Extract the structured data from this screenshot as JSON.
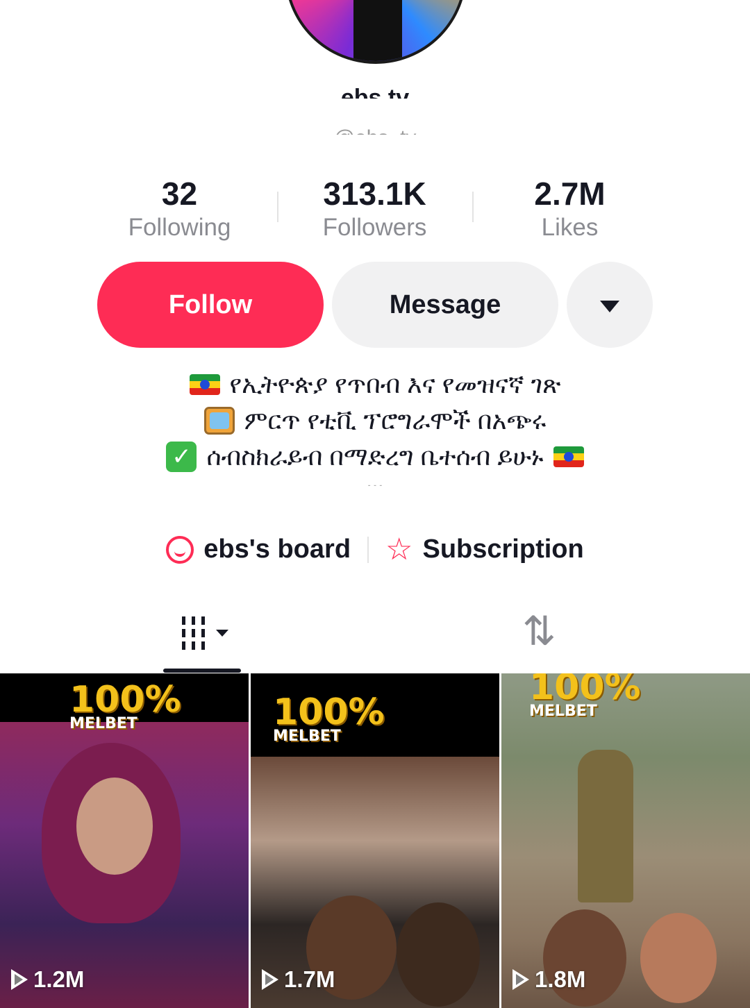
{
  "profile": {
    "display_name": "ebs tv",
    "handle": "@ebs_tv"
  },
  "stats": [
    {
      "value": "32",
      "label": "Following"
    },
    {
      "value": "313.1K",
      "label": "Followers"
    },
    {
      "value": "2.7M",
      "label": "Likes"
    }
  ],
  "actions": {
    "follow_label": "Follow",
    "message_label": "Message"
  },
  "bio": {
    "line1": "የኢትዮጵያ የጥበብ እና የመዝናኛ ገጽ",
    "line2": "ምርጥ የቲቪ ፕሮግራሞች በአጭሩ",
    "line3": "ሰብስክራይብ በማድረግ ቤተሰብ ይሁኑ",
    "line4_partial": "..."
  },
  "links": {
    "board_label": "ebs's board",
    "subscription_label": "Subscription"
  },
  "videos": [
    {
      "views": "1.2M",
      "badge_text": "100%",
      "badge_sub": "MELBET"
    },
    {
      "views": "1.7M",
      "badge_text": "100%",
      "badge_sub": "MELBET"
    },
    {
      "views": "1.8M",
      "badge_text": "100%",
      "badge_sub": "MELBET"
    }
  ],
  "colors": {
    "accent": "#fe2c55",
    "secondary_button": "#f1f1f2",
    "muted_text": "#8a8b91"
  },
  "icons": {
    "board": "board-icon",
    "subscription": "star-icon",
    "grid_tab": "grid-icon",
    "repost_tab": "repost-icon",
    "more": "chevron-down-icon",
    "play": "play-icon"
  }
}
